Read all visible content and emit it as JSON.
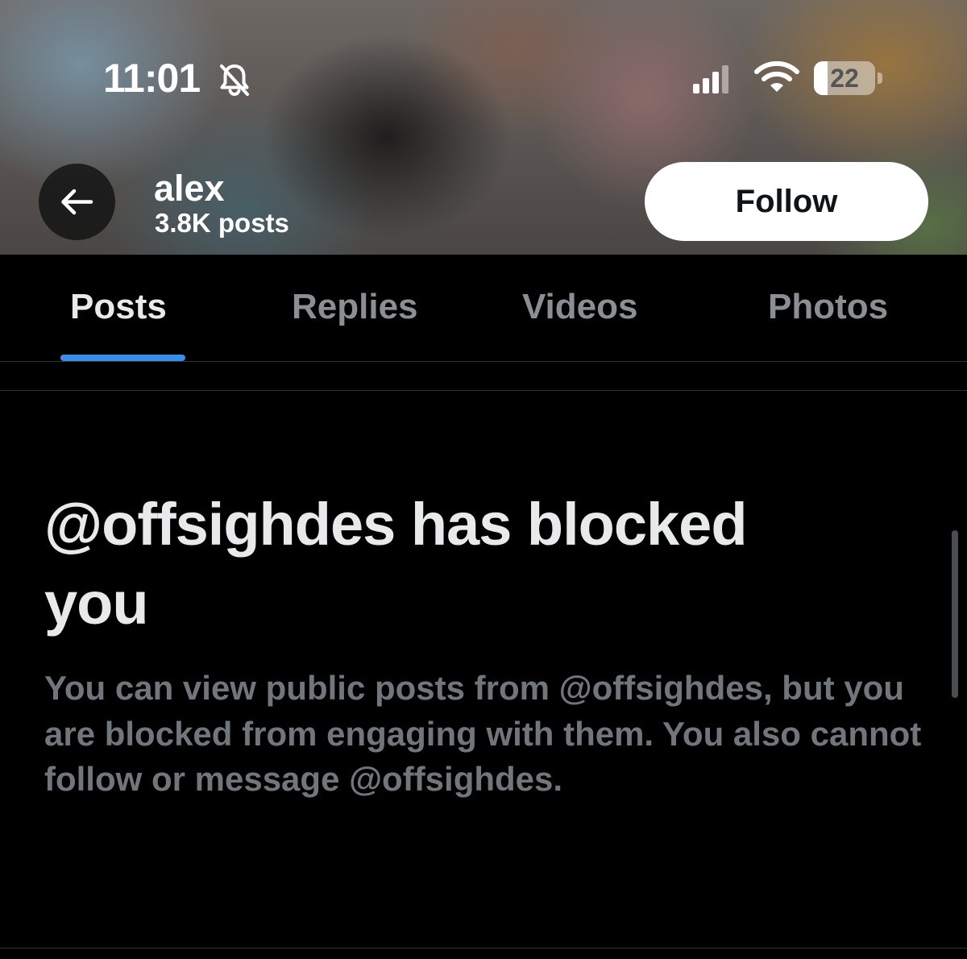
{
  "status_bar": {
    "time": "11:01",
    "battery_level": 22,
    "battery_label": "22",
    "icons": [
      "bell-slash-icon",
      "cellular-signal-icon",
      "wifi-icon",
      "battery-icon"
    ]
  },
  "header": {
    "back_icon": "arrow-left-icon",
    "name": "alex",
    "post_count": "3.8K posts",
    "follow_label": "Follow"
  },
  "tabs": [
    {
      "label": "Posts",
      "active": true
    },
    {
      "label": "Replies",
      "active": false
    },
    {
      "label": "Videos",
      "active": false
    },
    {
      "label": "Photos",
      "active": false
    }
  ],
  "blocked_notice": {
    "title": "@offsighdes has blocked you",
    "body": "You can view public posts from @offsighdes, but you are blocked from engaging with them. You also cannot follow or message @offsighdes."
  },
  "colors": {
    "accent": "#1d9bf0",
    "background": "#000000",
    "primary_text": "#e7e9ea",
    "secondary_text": "#71767b"
  }
}
